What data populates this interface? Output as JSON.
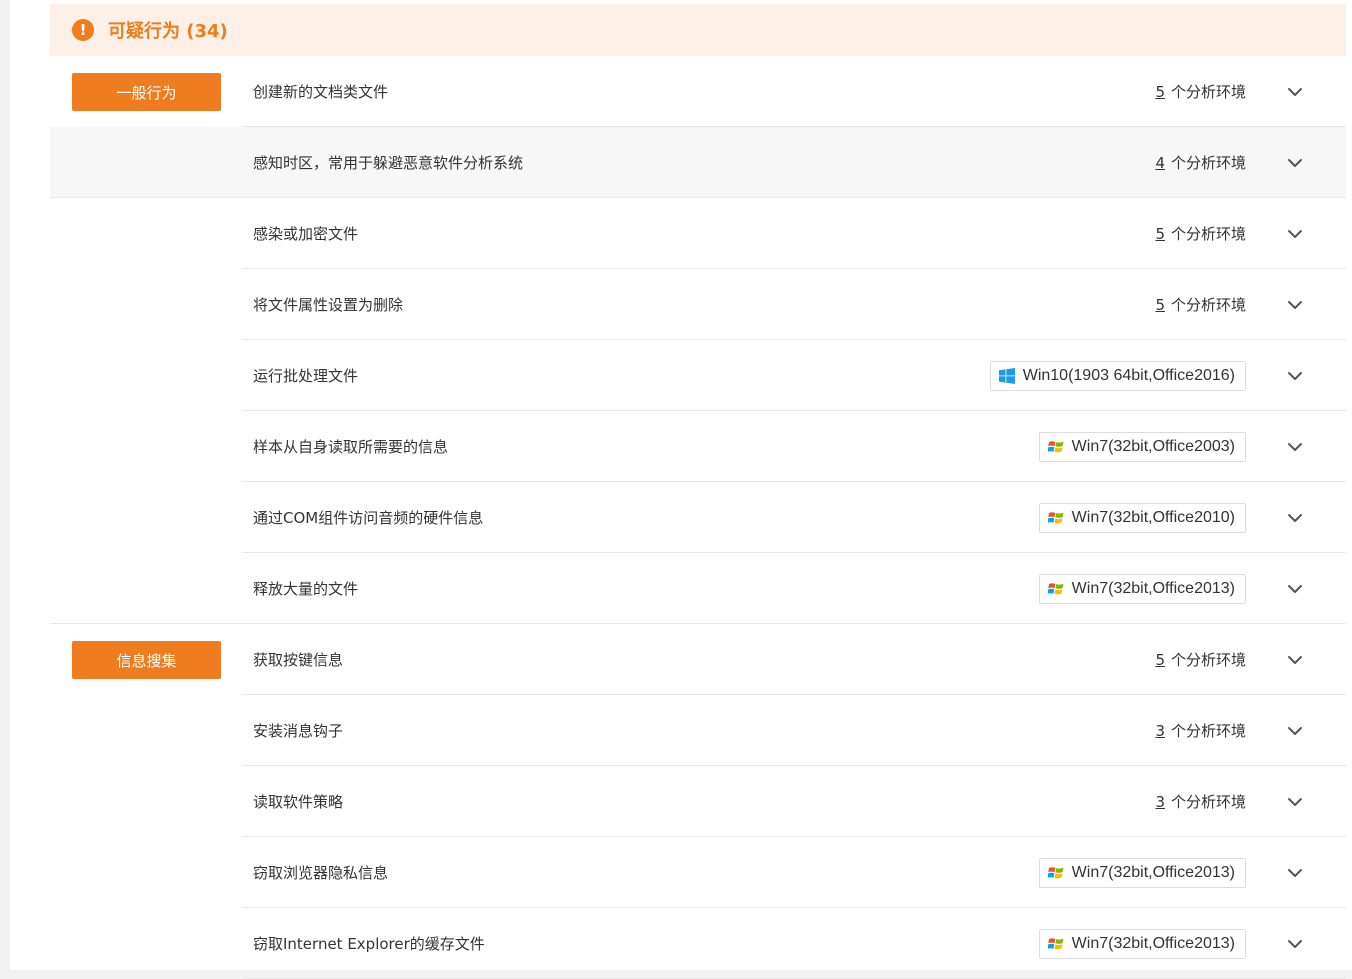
{
  "section": {
    "title": "可疑行为 (34)",
    "accent_color": "#f07c20",
    "icon": "exclamation-circle-icon"
  },
  "count_suffix": "个分析环境",
  "rows": [
    {
      "category": "一般行为",
      "name": "创建新的文档类文件",
      "count": "5",
      "highlight": false
    },
    {
      "name": "感知时区，常用于躲避恶意软件分析系统",
      "count": "4",
      "highlight": true
    },
    {
      "name": "感染或加密文件",
      "count": "5"
    },
    {
      "name": "将文件属性设置为删除",
      "count": "5"
    },
    {
      "name": "运行批处理文件",
      "env": "Win10(1903 64bit,Office2016)",
      "os": "win10"
    },
    {
      "name": "样本从自身读取所需要的信息",
      "env": "Win7(32bit,Office2003)",
      "os": "win7"
    },
    {
      "name": "通过COM组件访问音频的硬件信息",
      "env": "Win7(32bit,Office2010)",
      "os": "win7"
    },
    {
      "name": "释放大量的文件",
      "env": "Win7(32bit,Office2013)",
      "os": "win7",
      "group_end": true
    },
    {
      "category": "信息搜集",
      "name": "获取按键信息",
      "count": "5"
    },
    {
      "name": "安装消息钩子",
      "count": "3"
    },
    {
      "name": "读取软件策略",
      "count": "3"
    },
    {
      "name": "窃取浏览器隐私信息",
      "env": "Win7(32bit,Office2013)",
      "os": "win7"
    },
    {
      "name": "窃取Internet Explorer的缓存文件",
      "env": "Win7(32bit,Office2013)",
      "os": "win7"
    }
  ]
}
